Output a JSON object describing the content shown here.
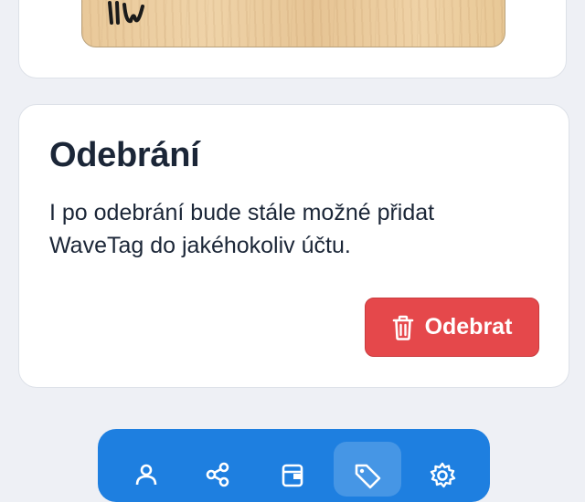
{
  "removal_card": {
    "title": "Odebrání",
    "text": "I po odebrání bude stále možné přidat WaveTag do jakéhokoliv účtu.",
    "button_label": "Odebrat"
  },
  "colors": {
    "page_background": "#eef0f5",
    "danger": "#e5484b",
    "nav_background": "#1e7fe0",
    "text": "#1b2637"
  },
  "bottom_nav": {
    "items": [
      {
        "icon": "user-icon",
        "active": false
      },
      {
        "icon": "share-icon",
        "active": false
      },
      {
        "icon": "wallet-icon",
        "active": false
      },
      {
        "icon": "tag-icon",
        "active": true
      },
      {
        "icon": "gear-icon",
        "active": false
      }
    ]
  }
}
